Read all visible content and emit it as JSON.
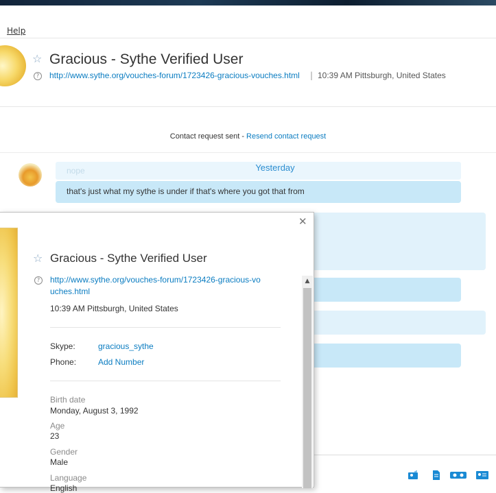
{
  "menu": {
    "help_label": "Help"
  },
  "header": {
    "name": "Gracious -  Sythe Verified User",
    "link": "http://www.sythe.org/vouches-forum/1723426-gracious-vouches.html",
    "separator": "|",
    "local_time_location": "10:39 AM Pittsburgh, United States"
  },
  "contact_request": {
    "status": "Contact request sent - ",
    "resend_label": "Resend contact request"
  },
  "conversation": {
    "partial_message": "nope",
    "date_divider": "Yesterday",
    "messages": [
      {
        "text": "that's just what my sythe is under if that's where you got that from"
      }
    ]
  },
  "profile_popup": {
    "close_icon": "close-icon",
    "name": "Gracious -  Sythe Verified User",
    "link": "http://www.sythe.org/vouches-forum/1723426-gracious-vouches.html",
    "local_time_location": "10:39 AM Pittsburgh, United States",
    "skype_label": "Skype:",
    "skype_value": "gracious_sythe",
    "phone_label": "Phone:",
    "phone_value": "Add Number",
    "fields": [
      {
        "label": "Birth date",
        "value": "Monday, August 3, 1992"
      },
      {
        "label": "Age",
        "value": "23"
      },
      {
        "label": "Gender",
        "value": "Male"
      },
      {
        "label": "Language",
        "value": "English"
      }
    ]
  },
  "bottom_icons": [
    "send-contact-icon",
    "send-file-icon",
    "voicemail-icon",
    "contact-card-icon"
  ],
  "colors": {
    "accent": "#0a7cc1",
    "bubble": "#c8e8f8",
    "bubble_light": "#e1f2fb"
  }
}
